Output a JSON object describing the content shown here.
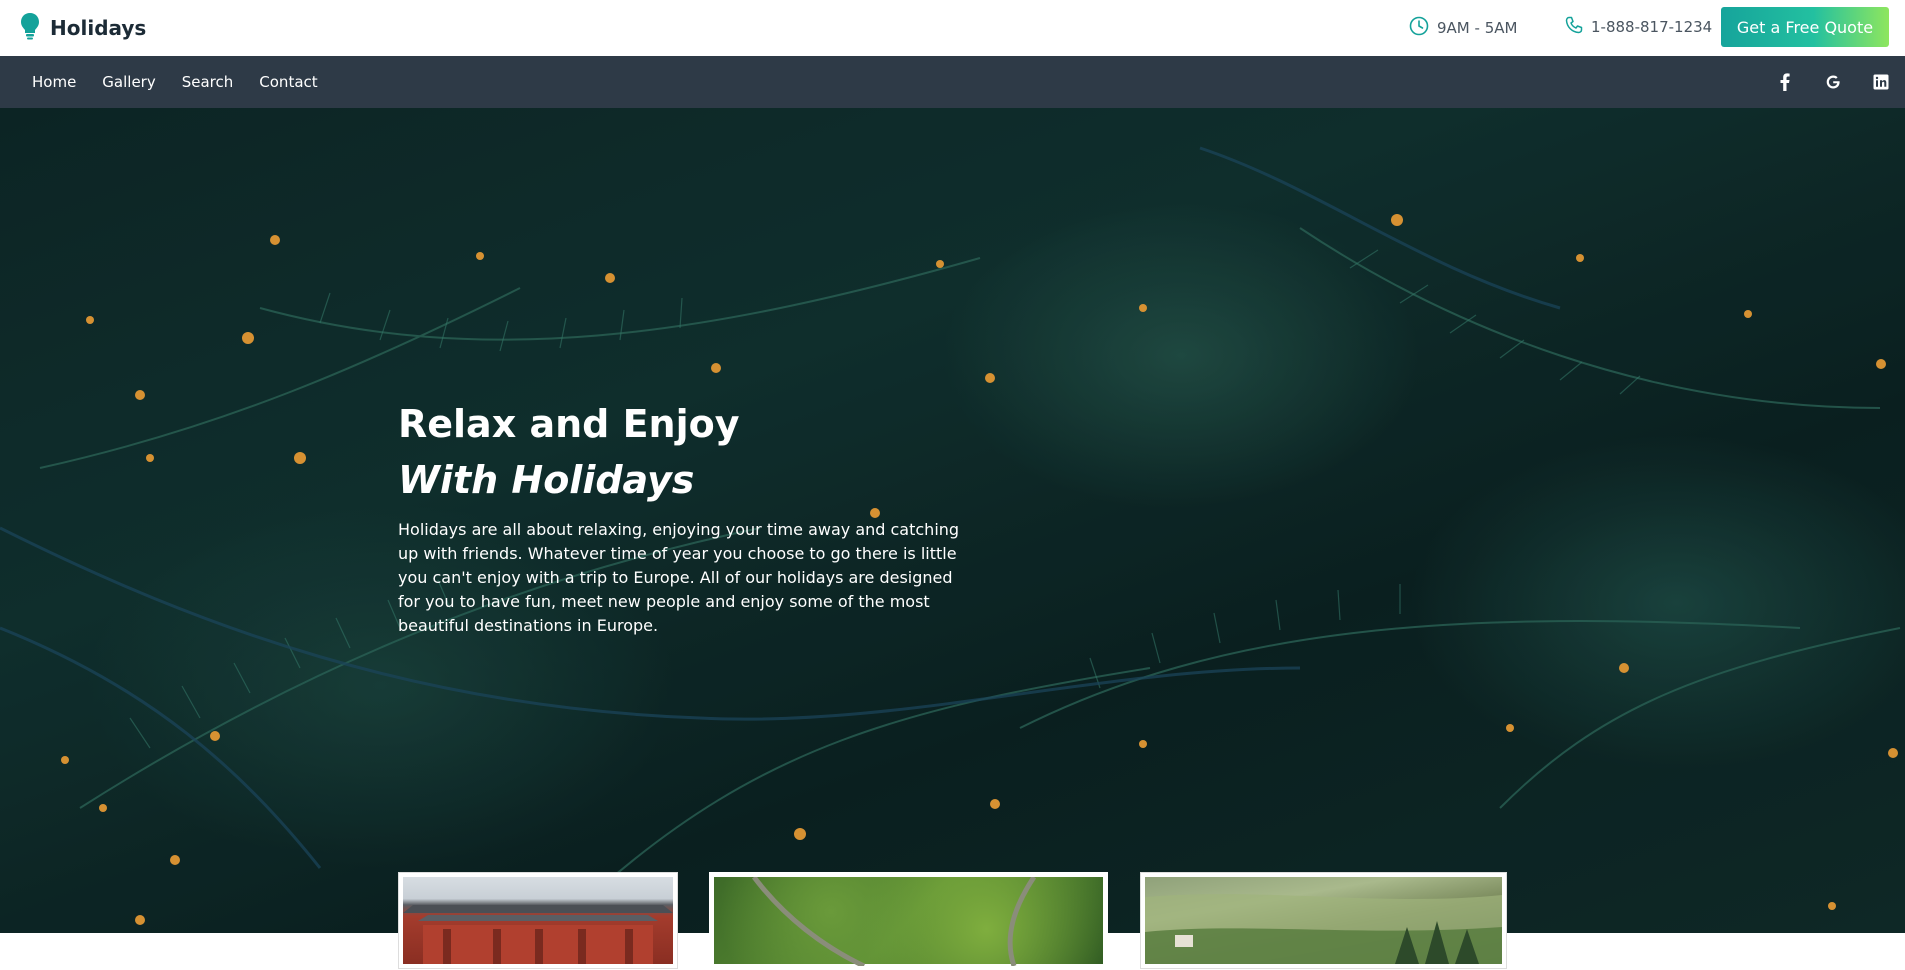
{
  "header": {
    "brand": "Holidays",
    "hours": "9AM - 5AM",
    "phone": "1-888-817-1234",
    "quote_button": "Get a Free Quote"
  },
  "nav": {
    "items": [
      {
        "label": "Home"
      },
      {
        "label": "Gallery"
      },
      {
        "label": "Search"
      },
      {
        "label": "Contact"
      }
    ],
    "social": [
      {
        "icon": "facebook-icon",
        "glyph": "f"
      },
      {
        "icon": "google-icon",
        "glyph": "G"
      },
      {
        "icon": "linkedin-icon",
        "glyph": "in"
      }
    ]
  },
  "hero": {
    "title_line1": "Relax and Enjoy",
    "title_line2": "With Holidays",
    "description": "Holidays are all about relaxing, enjoying your time away and catching up with friends. Whatever time of year you choose to go there is little you can't enjoy with a trip to Europe. All of our holidays are designed for you to have fun, meet new people and enjoy some of the most beautiful destinations in Europe."
  },
  "colors": {
    "accent_start": "#16a49b",
    "accent_end": "#8ee65e",
    "nav_bg": "#2e3a47",
    "brand_icon": "#14a29a"
  }
}
